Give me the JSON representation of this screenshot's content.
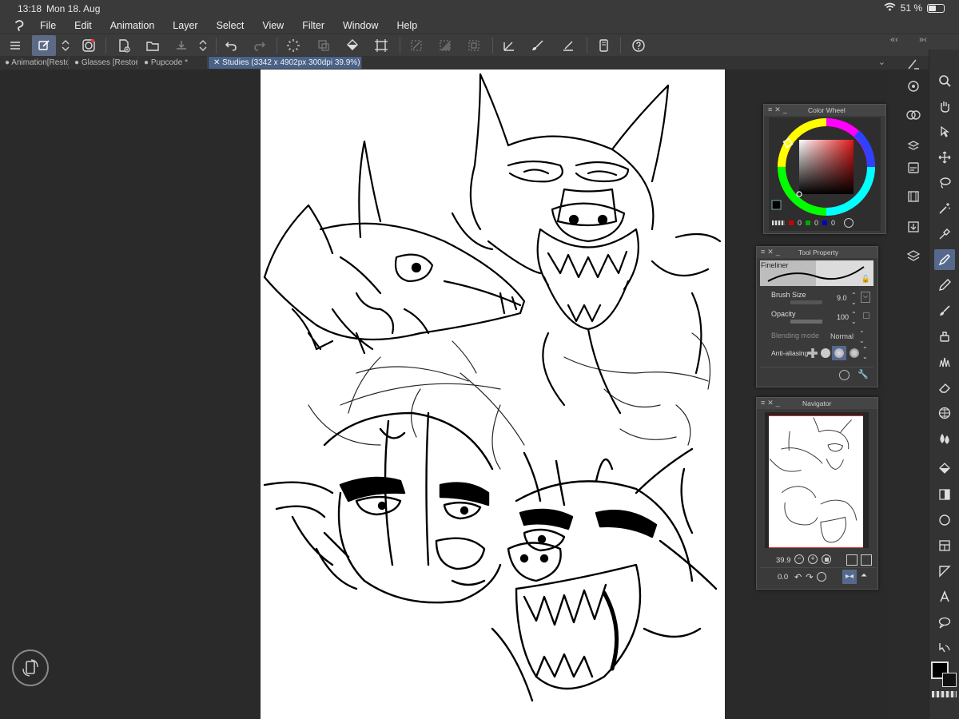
{
  "status": {
    "time": "13:18",
    "date": "Mon 18. Aug",
    "battery_text": "51 %",
    "battery_level": 0.51
  },
  "menu": {
    "items": [
      "File",
      "Edit",
      "Animation",
      "Layer",
      "Select",
      "View",
      "Filter",
      "Window",
      "Help"
    ]
  },
  "toolbar": {
    "icons": [
      "menu-icon",
      "edit-mode-icon",
      "updown-icon",
      "companion-icon",
      "new-file-icon",
      "open-folder-icon",
      "save-icon",
      "updown-icon",
      "undo-icon",
      "redo-icon",
      "loading-icon",
      "transform-icon",
      "fill-icon",
      "crop-icon",
      "select-all-icon",
      "invert-icon",
      "deselect-icon",
      "ruler-icon",
      "brush-icon",
      "line-icon",
      "phone-icon",
      "help-icon"
    ]
  },
  "tabs": [
    {
      "label": "Animation[Resto",
      "active": false
    },
    {
      "label": "Glasses [Restor",
      "active": false
    },
    {
      "label": "Pupcode *",
      "active": false
    },
    {
      "label": "Studies",
      "meta": "(3342 x 4902px 300dpi 39.9%)",
      "active": true
    }
  ],
  "color_wheel": {
    "title": "Color Wheel",
    "rgb": [
      "0",
      "0",
      "0"
    ],
    "colors": {
      "main": "#000000",
      "sub": "#ffffff"
    }
  },
  "tool_property": {
    "title": "Tool Property",
    "brush_name": "Fineliner",
    "brush_size_label": "Brush Size",
    "brush_size_value": "9.0",
    "opacity_label": "Opacity",
    "opacity_value": "100",
    "blending_label": "Blending mode",
    "blending_value": "Normal",
    "antialias_label": "Anti-aliasing"
  },
  "navigator": {
    "title": "Navigator",
    "zoom_value": "39.9",
    "rotation_value": "0.0"
  },
  "colors": {
    "accent": "#56698c",
    "tab_active": "#4b6287",
    "panel": "#3a3a3a",
    "canvas_bg": "#2a2a2a"
  }
}
